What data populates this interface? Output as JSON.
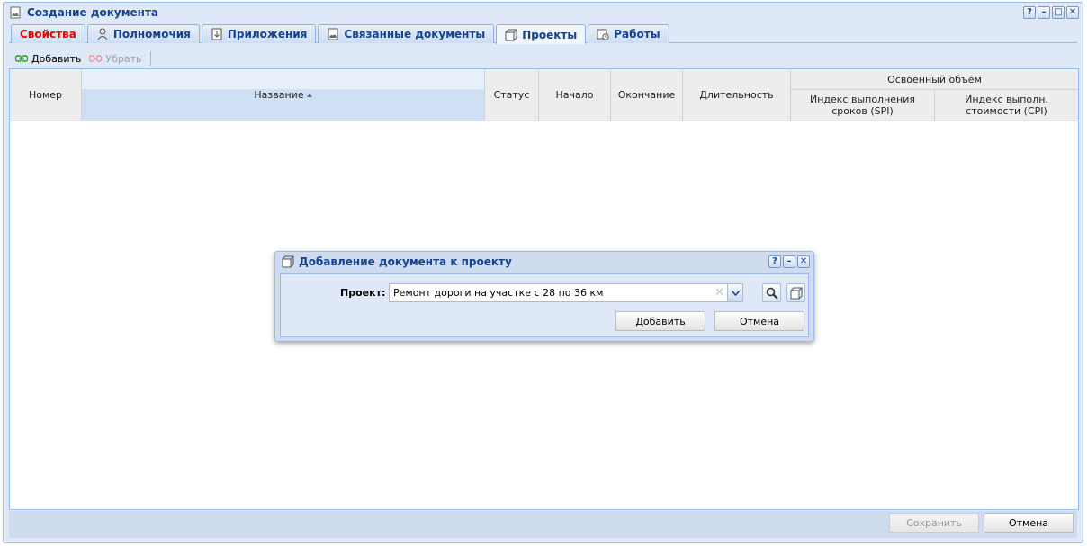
{
  "window": {
    "title": "Создание документа"
  },
  "tabs": [
    {
      "label": "Свойства",
      "icon": "none"
    },
    {
      "label": "Полномочия",
      "icon": "user-icon"
    },
    {
      "label": "Приложения",
      "icon": "attachment-icon"
    },
    {
      "label": "Связанные документы",
      "icon": "document-icon"
    },
    {
      "label": "Проекты",
      "icon": "projects-icon"
    },
    {
      "label": "Работы",
      "icon": "works-icon"
    }
  ],
  "active_tab": "Проекты",
  "toolbar": {
    "add_label": "Добавить",
    "remove_label": "Убрать"
  },
  "grid": {
    "columns": {
      "number": "Номер",
      "name": "Название",
      "status": "Статус",
      "start": "Начало",
      "end": "Окончание",
      "duration": "Длительность",
      "earned_group": "Освоенный объем",
      "spi": "Индекс выполнения сроков (SPI)",
      "cpi": "Индекс выполн. стоимости (CPI)"
    },
    "sorted_column": "Название",
    "rows": []
  },
  "footer": {
    "save_label": "Сохранить",
    "cancel_label": "Отмена"
  },
  "dialog": {
    "title": "Добавление документа к проекту",
    "project_label": "Проект:",
    "project_value": "Ремонт дороги на участке с 28 по 36 км",
    "add_label": "Добавить",
    "cancel_label": "Отмена"
  },
  "colors": {
    "title_text": "#15428b",
    "window_bg": "#dfe8f6",
    "border": "#99bbe8",
    "first_tab_text": "#e00000"
  }
}
